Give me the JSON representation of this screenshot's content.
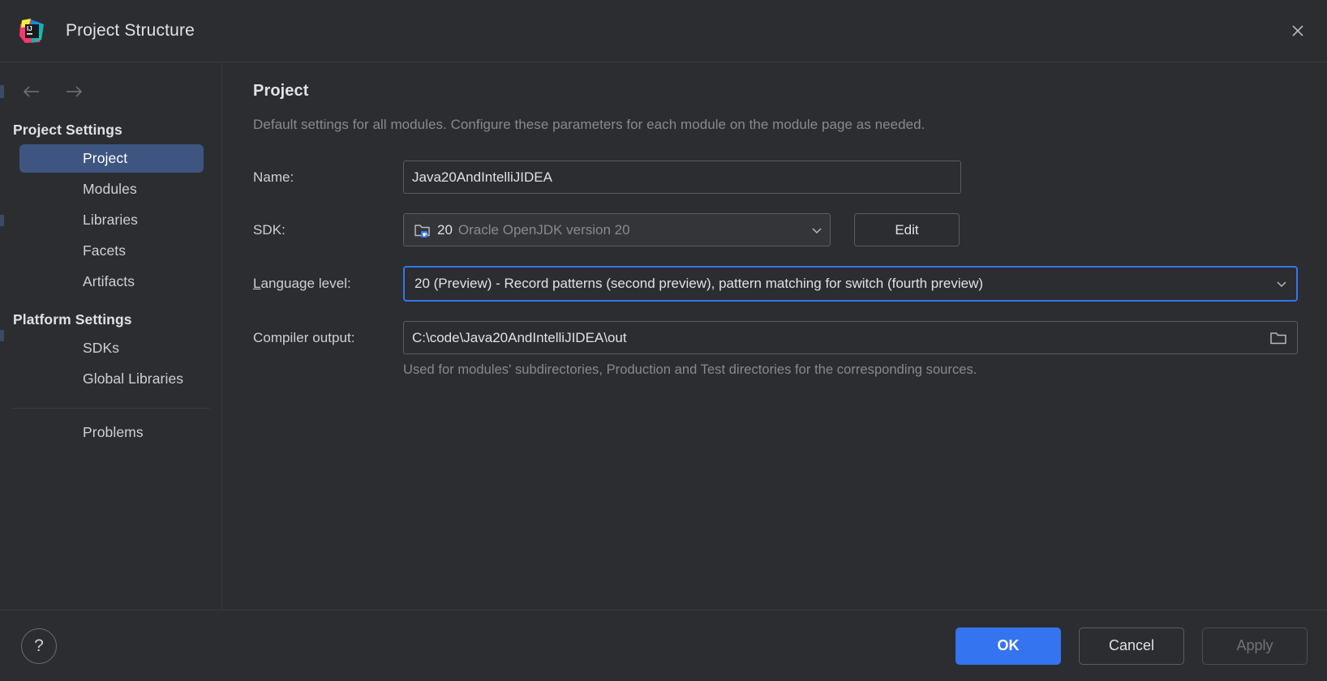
{
  "window": {
    "title": "Project Structure",
    "logo_text": "IJ",
    "close_label": "✕"
  },
  "nav": {
    "back_label": "←",
    "forward_label": "→"
  },
  "sidebar": {
    "groups": [
      {
        "header": "Project Settings",
        "items": [
          {
            "label": "Project",
            "selected": true
          },
          {
            "label": "Modules",
            "selected": false
          },
          {
            "label": "Libraries",
            "selected": false
          },
          {
            "label": "Facets",
            "selected": false
          },
          {
            "label": "Artifacts",
            "selected": false
          }
        ]
      },
      {
        "header": "Platform Settings",
        "items": [
          {
            "label": "SDKs",
            "selected": false
          },
          {
            "label": "Global Libraries",
            "selected": false
          }
        ]
      }
    ],
    "problems_label": "Problems"
  },
  "main": {
    "title": "Project",
    "description": "Default settings for all modules. Configure these parameters for each module on the module page as needed.",
    "name_label": "Name:",
    "name_value": "Java20AndIntelliJIDEA",
    "sdk_label": "SDK:",
    "sdk_version": "20",
    "sdk_description": "Oracle OpenJDK version 20",
    "sdk_edit_label": "Edit",
    "language_level_label_prefix": "L",
    "language_level_label_rest": "anguage level:",
    "language_level_value": "20 (Preview) - Record patterns (second preview), pattern matching for switch (fourth preview)",
    "compiler_output_label": "Compiler output:",
    "compiler_output_value": "C:\\code\\Java20AndIntelliJIDEA\\out",
    "compiler_output_hint": "Used for modules' subdirectories, Production and Test directories for the corresponding sources."
  },
  "footer": {
    "help_label": "?",
    "ok_label": "OK",
    "cancel_label": "Cancel",
    "apply_label": "Apply"
  },
  "colors": {
    "accent": "#3574f0",
    "selection": "#3d5580",
    "background": "#2b2d30",
    "text": "#dfe1e5",
    "muted": "#868a91"
  }
}
